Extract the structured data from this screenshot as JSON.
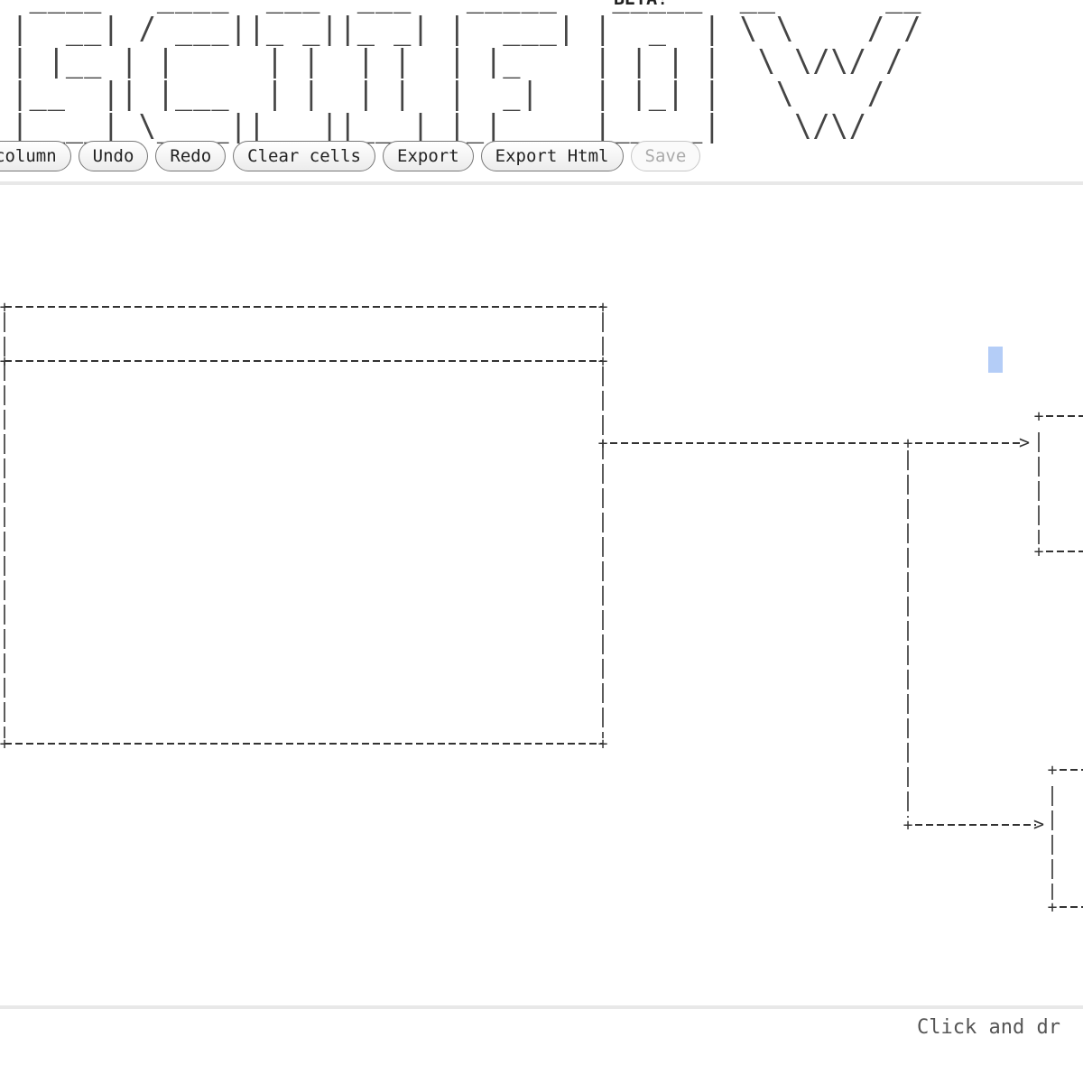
{
  "header": {
    "logo_text": "ASCIIFLOW",
    "beta_label": "BETA!"
  },
  "toolbar": {
    "add_column_label": "column",
    "undo_label": "Undo",
    "redo_label": "Redo",
    "clear_cells_label": "Clear cells",
    "export_label": "Export",
    "export_html_label": "Export Html",
    "save_label": "Save"
  },
  "diagram": {
    "stroke_color": "#333333",
    "cursor_color": "#b4cdf7",
    "arrowhead_glyph": ">",
    "corner_glyph": "+"
  },
  "status": {
    "hint_text": "Click and dr"
  }
}
